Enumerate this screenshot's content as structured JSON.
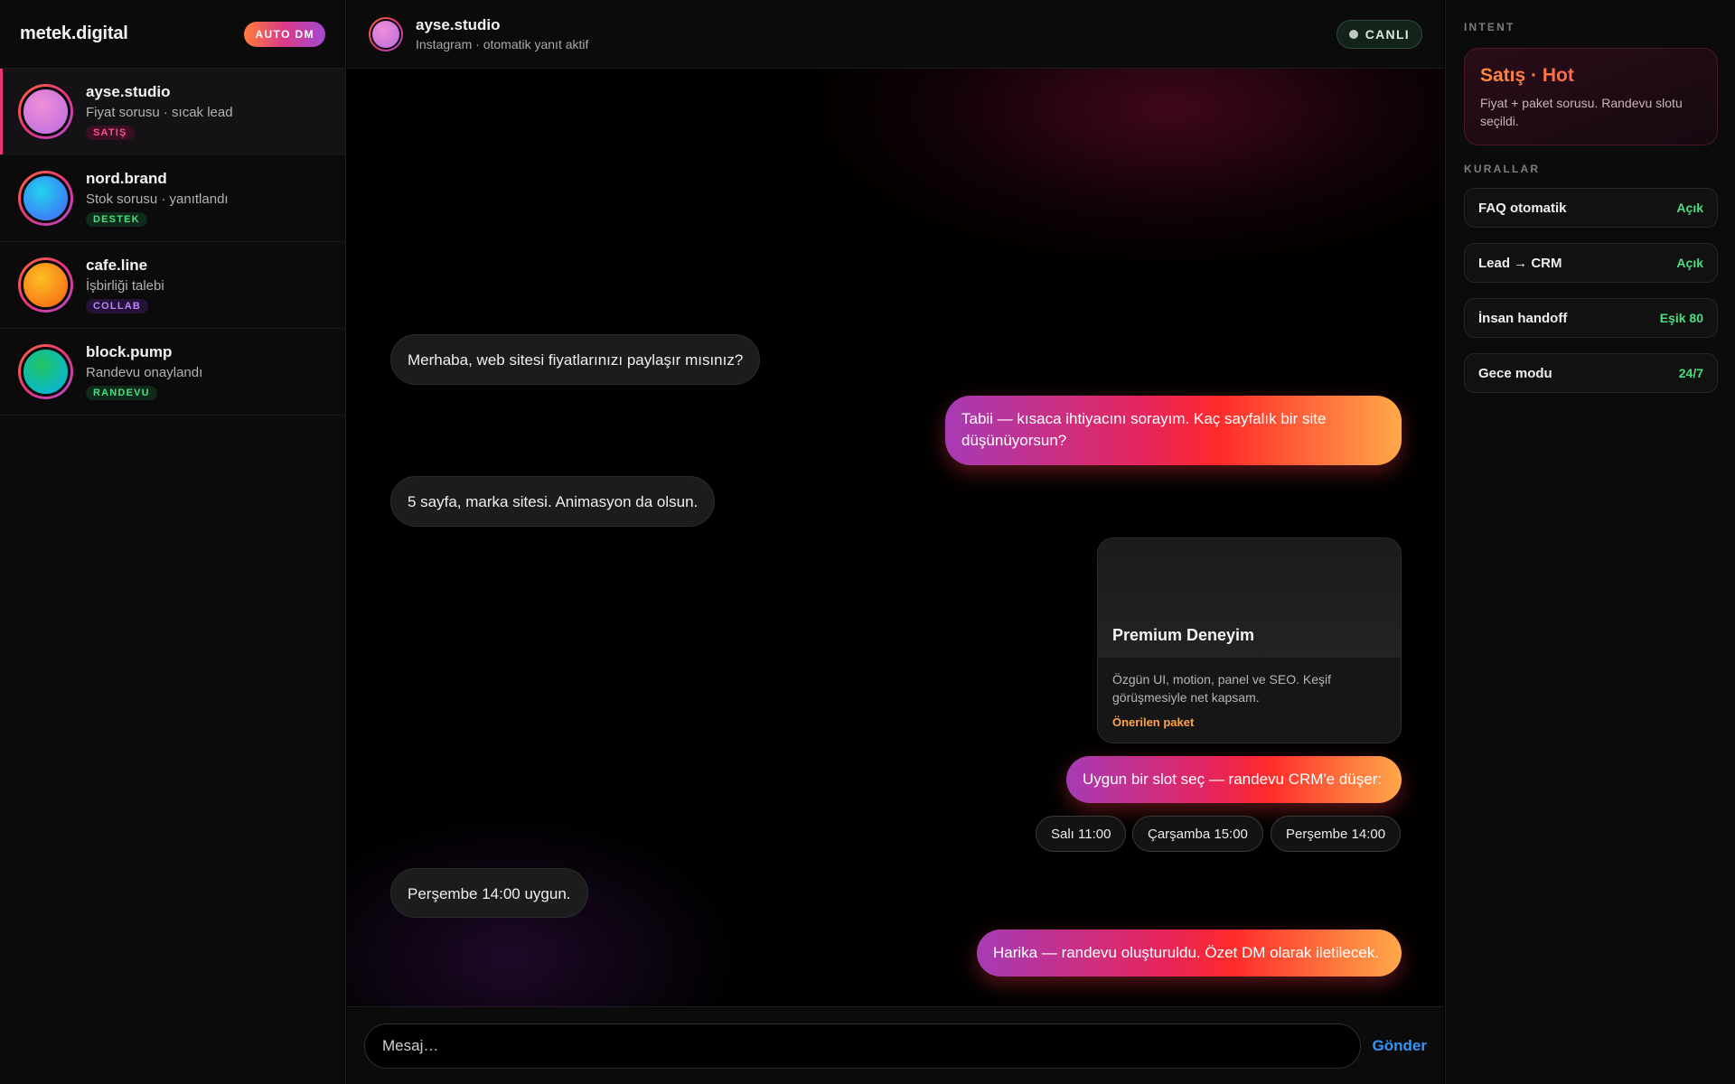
{
  "sidebar": {
    "brand": "metek.digital",
    "badge": "AUTO DM",
    "conversations": [
      {
        "name": "ayse.studio",
        "preview": "Fiyat sorusu · sıcak lead",
        "tag": "SATIŞ",
        "tag_color": "#ff4d8d",
        "tag_bg": "#3a0f22",
        "avatar_from": "#f08ed8",
        "avatar_to": "#b96be0"
      },
      {
        "name": "nord.brand",
        "preview": "Stok sorusu · yanıtlandı",
        "tag": "DESTEK",
        "tag_color": "#4ade80",
        "tag_bg": "#0f2a1a",
        "avatar_from": "#3b82f6",
        "avatar_to": "#22d3ee"
      },
      {
        "name": "cafe.line",
        "preview": "İşbirliği talebi",
        "tag": "COLLAB",
        "tag_color": "#c084fc",
        "tag_bg": "#241238",
        "avatar_from": "#fbbf24",
        "avatar_to": "#f97316"
      },
      {
        "name": "block.pump",
        "preview": "Randevu onaylandı",
        "tag": "RANDEVU",
        "tag_color": "#4ade80",
        "tag_bg": "#0f2a1a",
        "avatar_from": "#22c55e",
        "avatar_to": "#06b6d4"
      }
    ]
  },
  "chat": {
    "header": {
      "name": "ayse.studio",
      "sub": "Instagram · otomatik yanıt aktif",
      "status": "CANLI"
    },
    "messages": {
      "m1": "Merhaba, web sitesi fiyatlarınızı paylaşır mısınız?",
      "m2": "Tabii — kısaca ihtiyacını sorayım. Kaç sayfalık bir site düşünüyorsun?",
      "m3": "5 sayfa, marka sitesi. Animasyon da olsun.",
      "m4": "Uygun bir slot seç — randevu CRM'e düşer:",
      "m5": "Perşembe 14:00 uygun.",
      "m6": "Harika — randevu oluşturuldu. Özet DM olarak iletilecek."
    },
    "card": {
      "title": "Premium Deneyim",
      "desc": "Özgün UI, motion, panel ve SEO. Keşif görüşmesiyle net kapsam.",
      "footer": "Önerilen paket"
    },
    "slots": [
      "Salı 11:00",
      "Çarşamba 15:00",
      "Perşembe 14:00"
    ],
    "composer": {
      "placeholder": "Mesaj…",
      "send": "Gönder"
    }
  },
  "panel": {
    "intent_label": "INTENT",
    "intent_title": "Satış · Hot",
    "intent_desc": "Fiyat + paket sorusu. Randevu slotu seçildi.",
    "rules_label": "KURALLAR",
    "rules": [
      {
        "name": "FAQ otomatik",
        "value": "Açık"
      },
      {
        "name": "Lead → CRM",
        "value": "Açık"
      },
      {
        "name": "İnsan handoff",
        "value": "Eşik 80"
      },
      {
        "name": "Gece modu",
        "value": "24/7"
      }
    ]
  },
  "colors": {
    "accent": "#e7357a",
    "send": "#2f95ff",
    "rule_value": "#4ade80",
    "intent": "#ff3d5a"
  }
}
